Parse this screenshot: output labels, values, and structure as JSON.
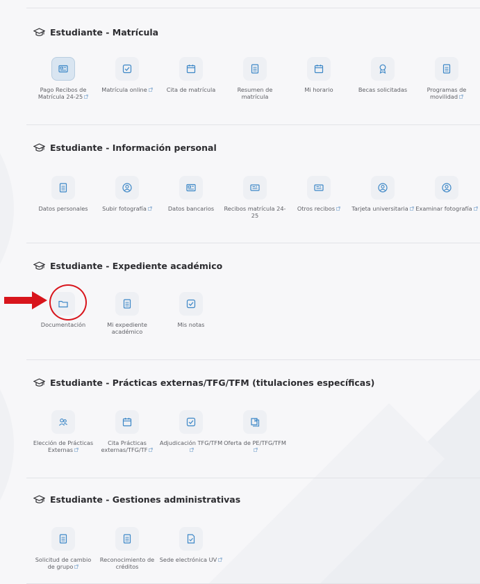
{
  "sections": [
    {
      "title": "Estudiante - Matrícula",
      "items": [
        {
          "label": "Pago Recibos de Matrícula 24-25",
          "icon": "id-card-icon",
          "external": true,
          "active": true
        },
        {
          "label": "Matrícula online",
          "icon": "checkbox-icon",
          "external": true
        },
        {
          "label": "Cita de matrícula",
          "icon": "calendar-icon",
          "external": false
        },
        {
          "label": "Resumen de matrícula",
          "icon": "document-icon",
          "external": false
        },
        {
          "label": "Mi horario",
          "icon": "calendar-icon",
          "external": false
        },
        {
          "label": "Becas solicitadas",
          "icon": "award-icon",
          "external": false
        },
        {
          "label": "Programas de movilidad",
          "icon": "document-icon",
          "external": true
        }
      ]
    },
    {
      "title": "Estudiante - Información personal",
      "items": [
        {
          "label": "Datos personales",
          "icon": "document-icon",
          "external": false
        },
        {
          "label": "Subir fotografía",
          "icon": "user-circle-icon",
          "external": true
        },
        {
          "label": "Datos bancarios",
          "icon": "id-card-icon",
          "external": false
        },
        {
          "label": "Recibos matrícula 24-25",
          "icon": "receipt-icon",
          "external": false
        },
        {
          "label": "Otros recibos",
          "icon": "receipt-icon",
          "external": true
        },
        {
          "label": "Tarjeta universitaria",
          "icon": "user-circle-icon",
          "external": true
        },
        {
          "label": "Examinar fotografía",
          "icon": "user-circle-icon",
          "external": true
        }
      ]
    },
    {
      "title": "Estudiante - Expediente académico",
      "items": [
        {
          "label": "Documentación",
          "icon": "folder-icon",
          "external": false
        },
        {
          "label": "Mi expediente académico",
          "icon": "document-icon",
          "external": false
        },
        {
          "label": "Mis notas",
          "icon": "checkbox-icon",
          "external": false
        }
      ]
    },
    {
      "title": "Estudiante - Prácticas externas/TFG/TFM (titulaciones específicas)",
      "items": [
        {
          "label": "Elección de Prácticas Externas",
          "icon": "users-icon",
          "external": true
        },
        {
          "label": "Cita Prácticas externas/TFG/TF",
          "icon": "calendar-icon",
          "external": true
        },
        {
          "label": "Adjudicación TFG/TFM",
          "icon": "checkbox-icon",
          "external": true
        },
        {
          "label": "Oferta de PE/TFG/TFM",
          "icon": "book-icon",
          "external": true
        }
      ]
    },
    {
      "title": "Estudiante - Gestiones administrativas",
      "items": [
        {
          "label": "Solicitud de cambio de grupo",
          "icon": "document-icon",
          "external": true
        },
        {
          "label": "Reconocimiento de créditos",
          "icon": "document-icon",
          "external": false
        },
        {
          "label": "Sede electrónica UV",
          "icon": "file-check-icon",
          "external": true
        }
      ]
    }
  ],
  "colors": {
    "icon_stroke": "#3b86c6",
    "tile_bg": "#eef0f4",
    "highlight_red": "#d8151c",
    "title_text": "#2c2c30",
    "label_text": "#5f6066"
  }
}
